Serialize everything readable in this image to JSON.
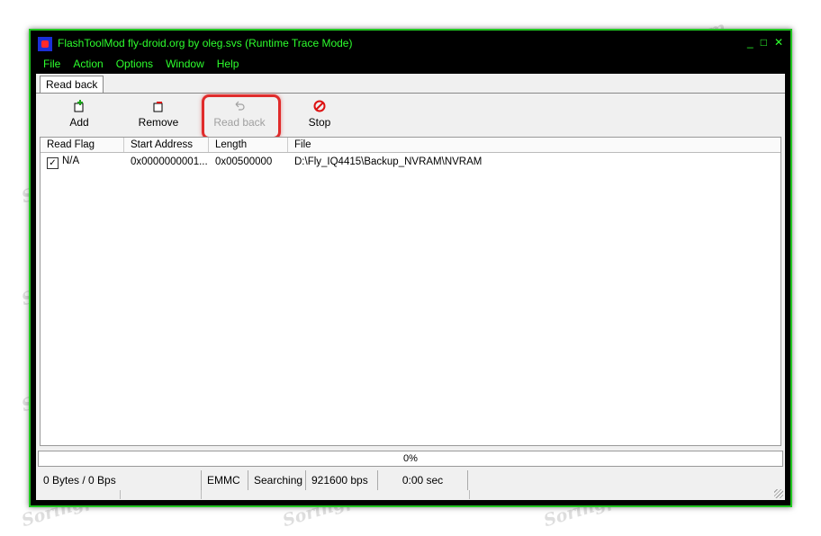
{
  "window": {
    "title": "FlashToolMod fly-droid.org by oleg.svs (Runtime Trace Mode)",
    "controls": {
      "minimize": "_",
      "maximize": "□",
      "close": "✕"
    }
  },
  "menu": [
    "File",
    "Action",
    "Options",
    "Window",
    "Help"
  ],
  "tab": {
    "label": "Read back"
  },
  "toolbar": {
    "add": "Add",
    "remove": "Remove",
    "read_back": "Read back",
    "stop": "Stop"
  },
  "table": {
    "headers": [
      "Read Flag",
      "Start Address",
      "Length",
      "File"
    ],
    "rows": [
      {
        "flag": "N/A",
        "checked": true,
        "start": "0x0000000001...",
        "length": "0x00500000",
        "file": "D:\\Fly_IQ4415\\Backup_NVRAM\\NVRAM"
      }
    ]
  },
  "progress": {
    "text": "0%",
    "value": 0
  },
  "status": {
    "transfer": "0 Bytes / 0 Bps",
    "storage": "EMMC",
    "state": "Searching",
    "baud": "921600 bps",
    "time": "0:00 sec"
  },
  "watermark": "Soringperepair.com",
  "colors": {
    "frame": "#21c621",
    "title_text": "#2dff2d",
    "highlight": "#e02b2b"
  }
}
